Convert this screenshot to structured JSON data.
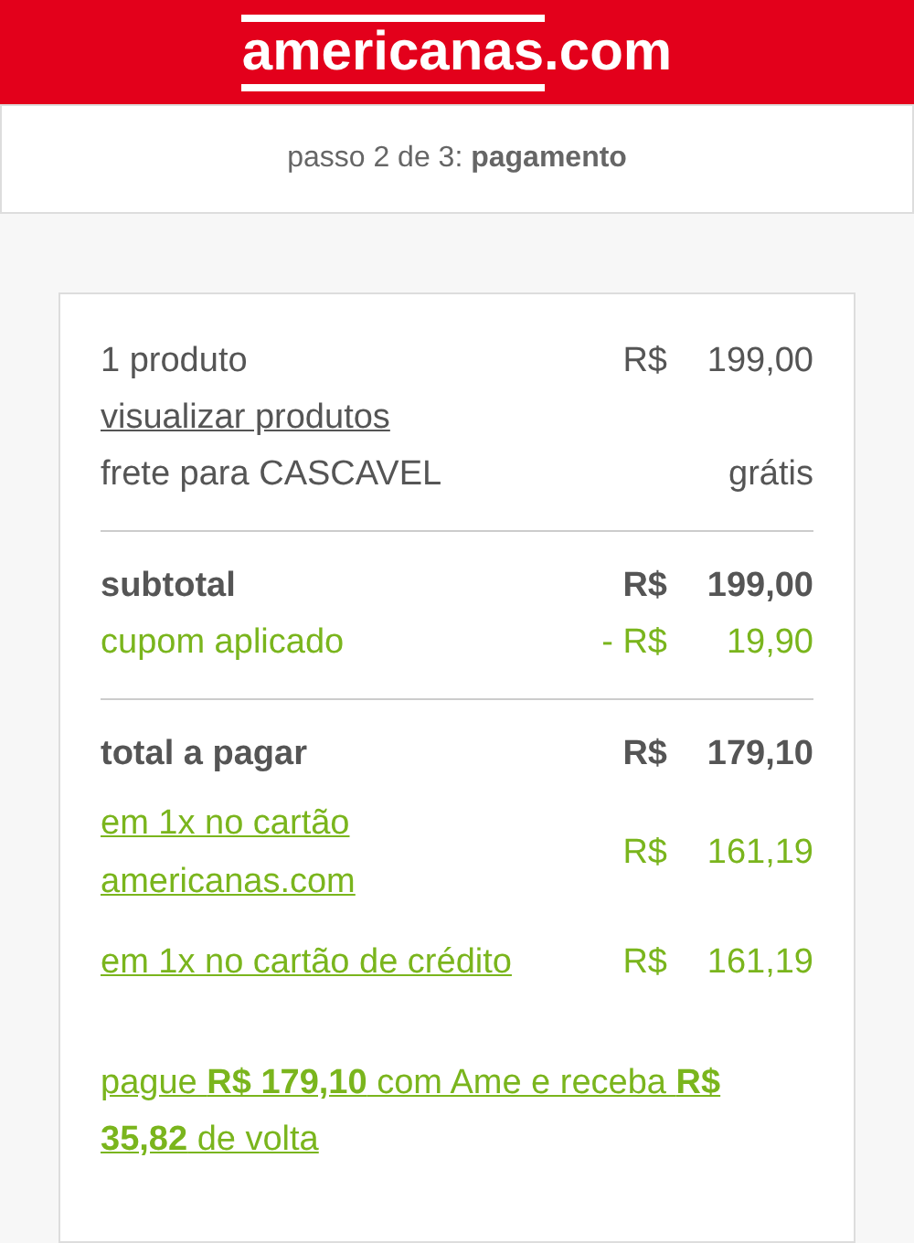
{
  "header": {
    "logo_main": "americanas",
    "logo_suffix": ".com"
  },
  "step": {
    "prefix": "passo 2 de 3:",
    "current": "pagamento"
  },
  "summary": {
    "groups": [
      [
        {
          "kind": "item",
          "label": "1 produto",
          "currency": "R$",
          "amount": "199,00"
        },
        {
          "kind": "link",
          "label": "visualizar produtos"
        },
        {
          "kind": "item",
          "label": "frete para CASCAVEL",
          "amount": "grátis"
        }
      ],
      [
        {
          "kind": "total",
          "label": "subtotal",
          "currency": "R$",
          "amount": "199,00"
        },
        {
          "kind": "discount",
          "label": "cupom aplicado",
          "currency": "- R$",
          "amount": "19,90"
        }
      ],
      [
        {
          "kind": "total",
          "label": "total a pagar",
          "currency": "R$",
          "amount": "179,10"
        },
        {
          "kind": "payment",
          "label": "em 1x no cartão americanas.com",
          "currency": "R$",
          "amount": "161,19"
        },
        {
          "kind": "payment",
          "label": "em 1x no cartão de crédito",
          "currency": "R$",
          "amount": "161,19"
        }
      ]
    ]
  },
  "ame_offer": "pague **R$ 179,10** com Ame e receba **R$ 35,82** de volta"
}
